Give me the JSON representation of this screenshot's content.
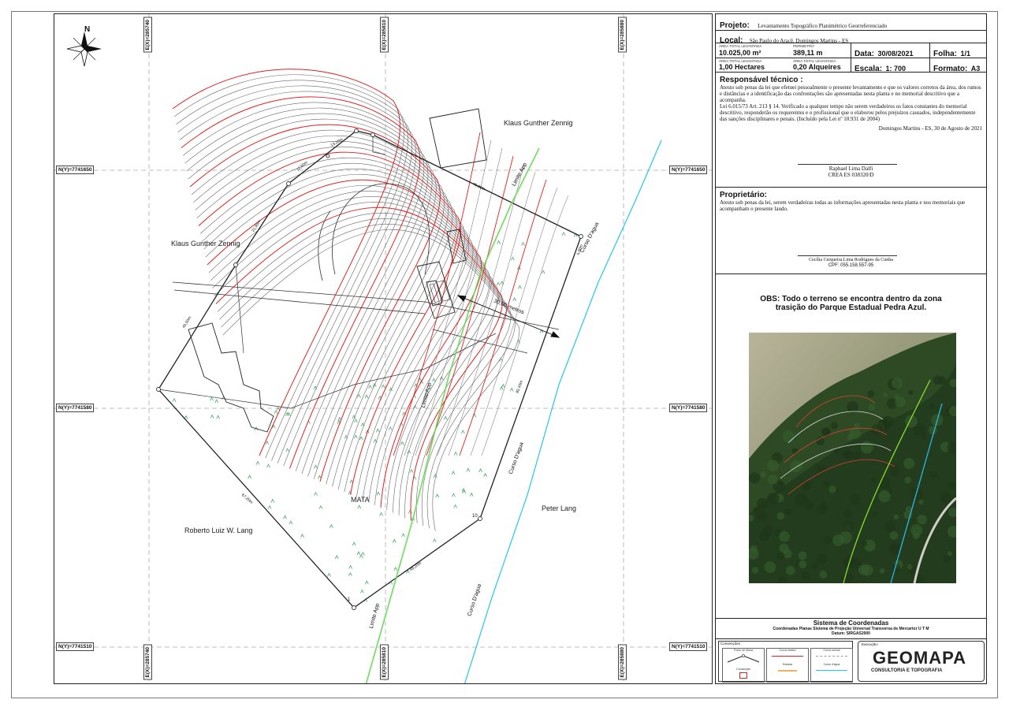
{
  "title_block": {
    "projeto_label": "Projeto:",
    "projeto": "Levantamento Topográfico Planimétrico Georreferenciado",
    "local_label": "Local:",
    "local": "São Paulo do Aracê, Domingos Martins - ES",
    "area_label": "ÁREA TOTAL LEVANTADA",
    "area_m2": "10.025,00 m²",
    "perimetro_label": "PERÍMETRO",
    "perimetro": "389,11 m",
    "data_label": "Data:",
    "data": "30/08/2021",
    "folha_label": "Folha:",
    "folha": "1/1",
    "area_ha": "1,00 Hectares",
    "area_alq": "0,20 Alqueires",
    "escala_label": "Escala:",
    "escala": "1: 700",
    "formato_label": "Formato:",
    "formato": "A3"
  },
  "responsavel": {
    "heading": "Responsável técnico :",
    "text1": "Atesto sob penas da lei que efetuei pessoalmente o presente levantamento e que os valores corretos da área, dos rumos e distâncias e a identificação das confrontações são apresentadas nesta planta e no memorial descritivo que a acompanha.",
    "text2": "Lei 6.015/73 Art. 213 § 14. Verificado a qualquer tempo não serem verdadeiros os fatos constantes do memorial descritivo, responderão os requerentes e o profissional que o elaborou pelos prejuízos causados, independentemente das sanções disciplinares e penais. (Incluído pela Lei nº 10.931 de 2004)",
    "place_date": "Domingos Martins - ES, 30 de Agosto de 2021",
    "signer": "Raphael Lima Dalfi",
    "crea": "CREA ES 038320/D"
  },
  "proprietario": {
    "heading": "Proprietário:",
    "text": "Atesto sob penas da lei, serem verdadeiras todas as informações apresentadas nesta planta e nos memoriais que acompanham o presente laudo.",
    "signer": "Cecília Cerqueira Lima Rodrigues da Cunha",
    "cpf": "CPF: 055.158.557-95"
  },
  "obs": {
    "line1": "OBS: Todo o terreno se encontra dentro da zona",
    "line2": "trasição do Parque Estadual Pedra Azul."
  },
  "sistema": {
    "heading": "Sistema de Coordenadas",
    "line": "Coordenadas Planas Sistema de Projeção Universal Transversa de Mercartor U T M",
    "datum": "Datum:  SIRGAS2000"
  },
  "legend": {
    "heading": "Convenções",
    "items": [
      "Ponto de divisa",
      "Curva mestra",
      "Curva normal",
      "Construção",
      "Estrada",
      "Curso d'água"
    ]
  },
  "logo": {
    "label": "Execução:",
    "name": "GEOMAPA",
    "sub": "CONSULTORIA E TOPOGRAFIA"
  },
  "map": {
    "north": "N",
    "grid_n": [
      "N(Y)=7741650",
      "N(Y)=7741580",
      "N(Y)=7741510"
    ],
    "grid_e": [
      "E(X)=285740",
      "E(X)=285810",
      "E(X)=285880"
    ],
    "owners": {
      "klaus_top": "Klaus Gunther Zennig",
      "klaus_left": "Klaus Gunther Zennig",
      "roberto": "Roberto Luiz W. Lang",
      "peter": "Peter Lang"
    },
    "mata": "MATA",
    "limite_app": "Limite App",
    "curso_dagua": "Curso D'agua",
    "distance_30": "30,00 metros",
    "edges": [
      "13,20m",
      "12,50m",
      "21,90m",
      "45,50m",
      "46,00m",
      "67,20m",
      "48,20m",
      "85,43m",
      "5,00m"
    ],
    "vertex_numbers": [
      "1",
      "10"
    ],
    "colors": {
      "contour": "#666666",
      "master_contour": "#e02020",
      "limite_app": "#44cc33",
      "stream": "#22c8e8",
      "vegetation": "#2e9e5a",
      "boundary": "#222222"
    }
  }
}
